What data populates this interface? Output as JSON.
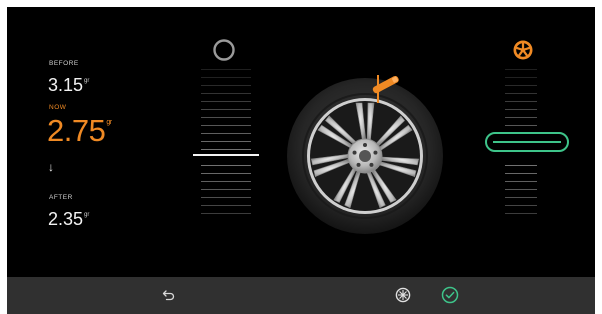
{
  "readout": {
    "before_label": "BEFORE",
    "before_value": "3.15",
    "before_unit": "gr",
    "now_label": "NOW",
    "now_value": "2.75",
    "now_unit": "gr",
    "arrow": "↓",
    "after_label": "AFTER",
    "after_value": "2.35",
    "after_unit": "gr"
  },
  "colors": {
    "accent_orange": "#f08a24",
    "selection_green": "#3ec48a",
    "background": "#000000",
    "bottom_bar": "#303030"
  },
  "icons": {
    "left_plane": "circle-outline-icon",
    "right_plane": "wheel-spokes-icon",
    "weight_marker": "weight-marker-icon",
    "back": "back-arrow-icon",
    "wheel_mode": "wheel-mode-icon",
    "confirm": "check-circle-icon"
  }
}
